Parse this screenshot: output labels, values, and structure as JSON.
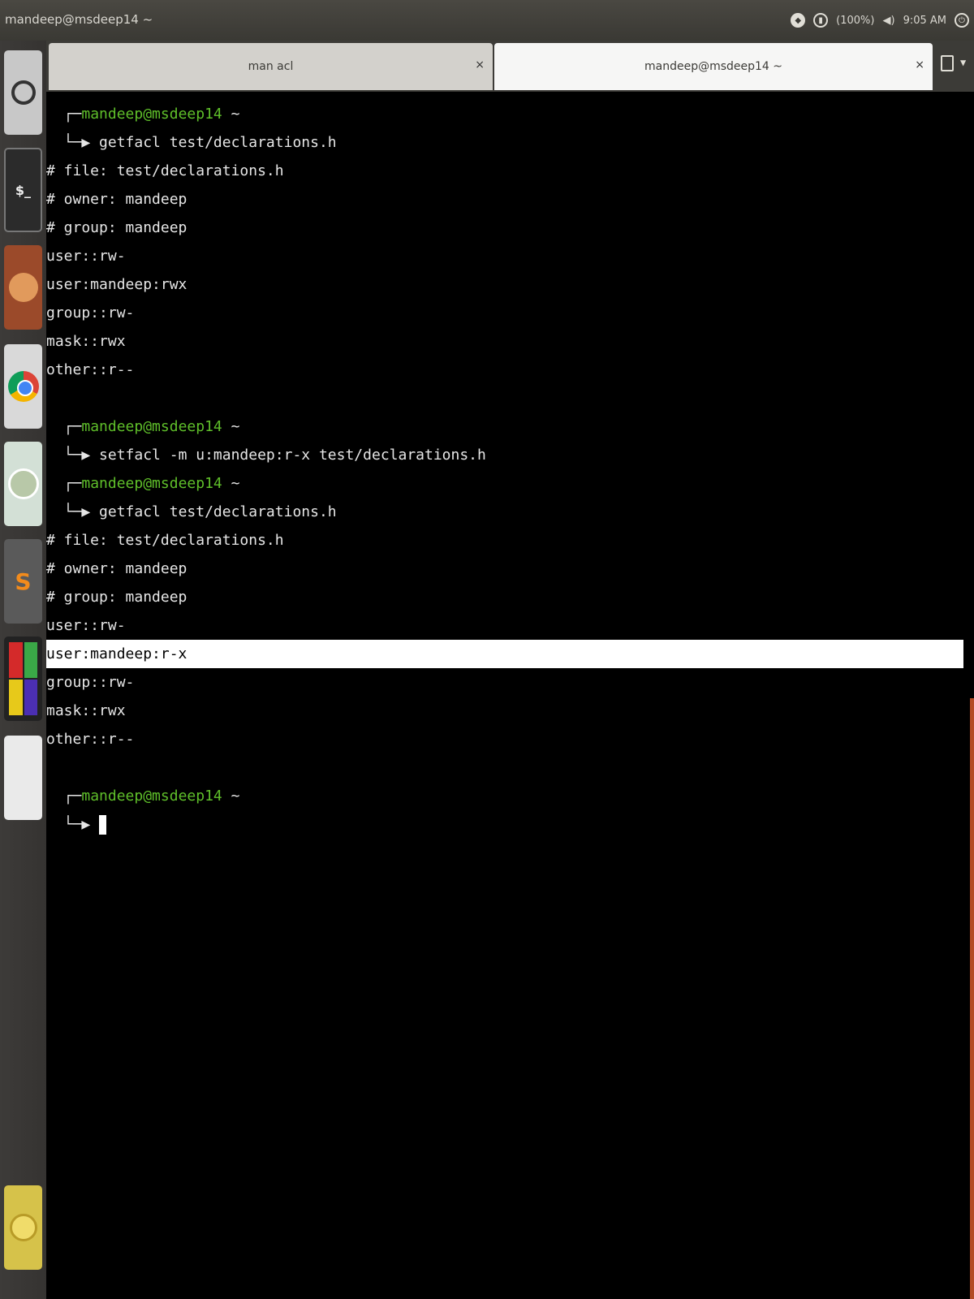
{
  "topbar": {
    "window_title": "mandeep@msdeep14 ~",
    "battery": "(100%)",
    "time": "9:05 AM"
  },
  "launcher": {
    "items": [
      {
        "name": "dash"
      },
      {
        "name": "terminal",
        "glyph": "$_"
      },
      {
        "name": "files"
      },
      {
        "name": "chrome"
      },
      {
        "name": "settings"
      },
      {
        "name": "sublime-text",
        "glyph": "S"
      },
      {
        "name": "apps"
      },
      {
        "name": "text-editor"
      },
      {
        "name": "trash"
      }
    ]
  },
  "tabs": [
    {
      "label": "man acl",
      "close": "×"
    },
    {
      "label": "mandeep@msdeep14 ~",
      "close": "×"
    }
  ],
  "terminal": {
    "lines": [
      {
        "user": "mandeep@msdeep14",
        "dir": " ~",
        "type": "prompt-head"
      },
      {
        "text": "getfacl test/declarations.h",
        "type": "prompt-cmd"
      },
      {
        "text": "# file: test/declarations.h"
      },
      {
        "text": "# owner: mandeep"
      },
      {
        "text": "# group: mandeep"
      },
      {
        "text": "user::rw-"
      },
      {
        "text": "user:mandeep:rwx"
      },
      {
        "text": "group::rw-"
      },
      {
        "text": "mask::rwx"
      },
      {
        "text": "other::r--"
      },
      {
        "text": ""
      },
      {
        "user": "mandeep@msdeep14",
        "dir": " ~",
        "type": "prompt-head"
      },
      {
        "text": "setfacl -m u:mandeep:r-x test/declarations.h",
        "type": "prompt-cmd"
      },
      {
        "user": "mandeep@msdeep14",
        "dir": " ~",
        "type": "prompt-head"
      },
      {
        "text": "getfacl test/declarations.h",
        "type": "prompt-cmd"
      },
      {
        "text": "# file: test/declarations.h"
      },
      {
        "text": "# owner: mandeep"
      },
      {
        "text": "# group: mandeep"
      },
      {
        "text": "user::rw-"
      },
      {
        "text": "user:mandeep:r-x",
        "highlight": true
      },
      {
        "text": "group::rw-"
      },
      {
        "text": "mask::rwx"
      },
      {
        "text": "other::r--"
      },
      {
        "text": ""
      },
      {
        "user": "mandeep@msdeep14",
        "dir": " ~",
        "type": "prompt-head"
      },
      {
        "text": "",
        "type": "prompt-cmd",
        "cursor": true
      }
    ]
  }
}
